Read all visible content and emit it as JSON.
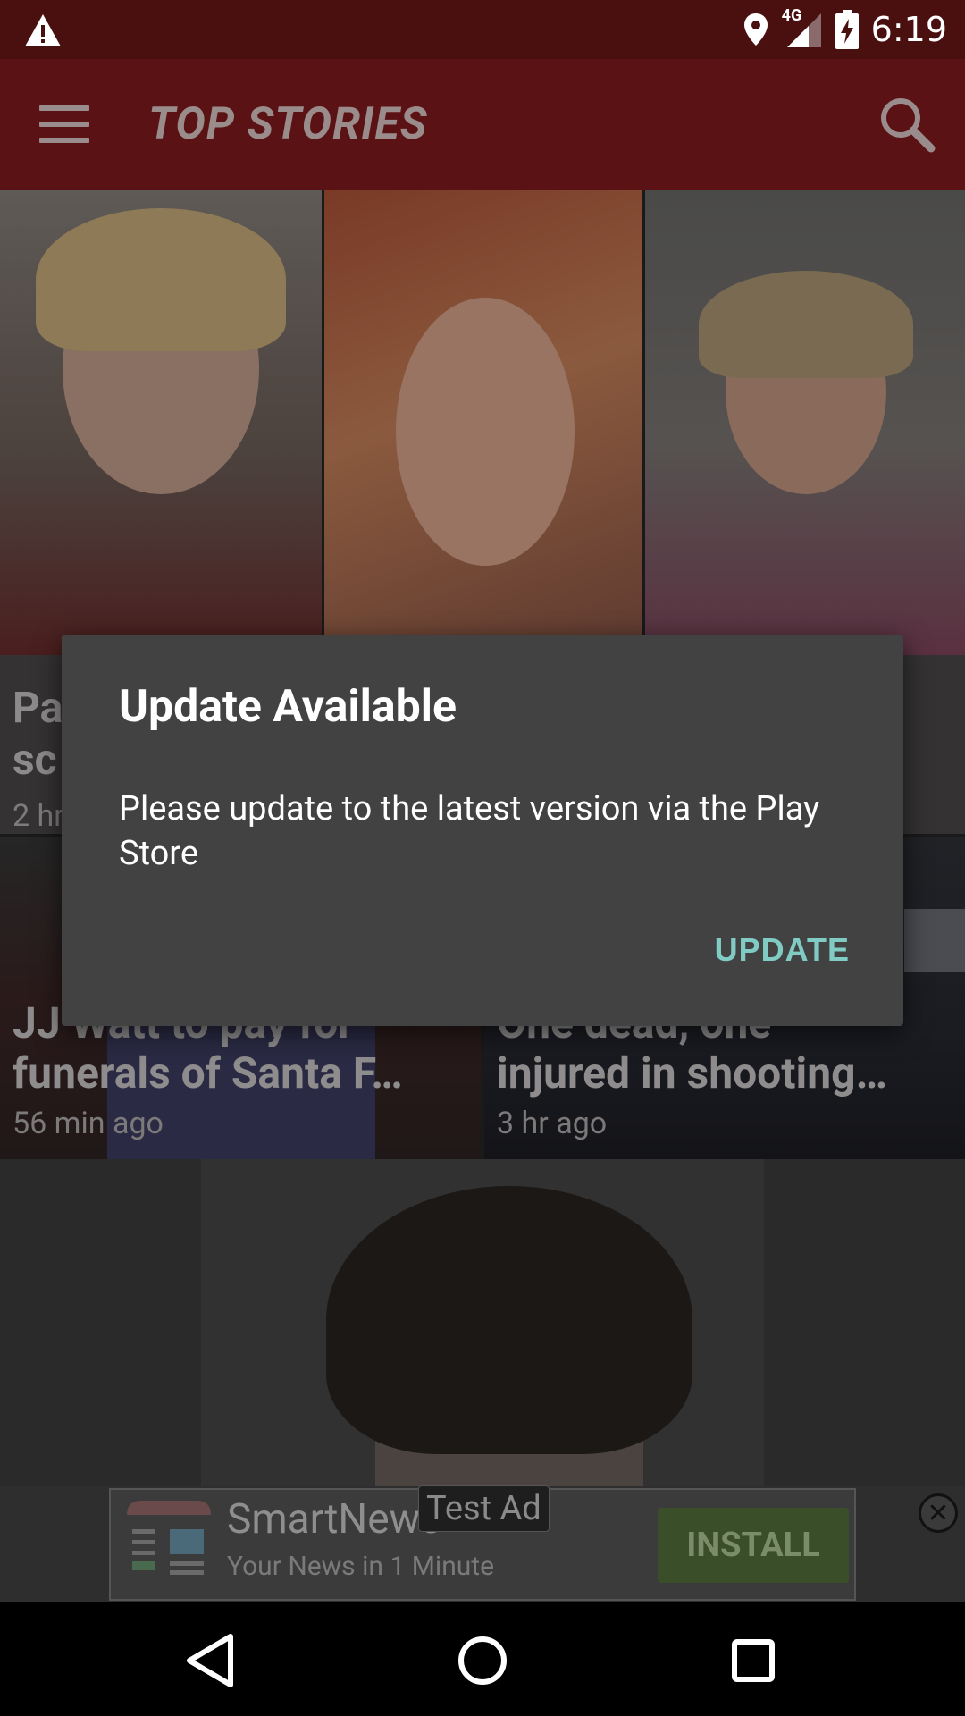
{
  "status_bar": {
    "time": "6:19",
    "network_label": "4G",
    "icons": [
      "warning-icon",
      "location-icon",
      "signal-icon",
      "battery-charging-icon"
    ]
  },
  "app_bar": {
    "title": "TOP STORIES",
    "icons": [
      "menu-icon",
      "search-icon"
    ]
  },
  "stories": [
    {
      "headline": "Pa                                                                          e\nsc",
      "ago": "2 hr"
    },
    {
      "headline": "JJ Watt to pay for\nfunerals of Santa F…",
      "ago": "56 min ago"
    },
    {
      "headline": "One dead, one\ninjured in shooting…",
      "ago": "3 hr ago"
    }
  ],
  "ad": {
    "app_name": "SmartNews",
    "tagline": "Your News in 1 Minute",
    "install_label": "INSTALL",
    "test_label": "Test Ad",
    "close_symbol": "✕"
  },
  "dialog": {
    "title": "Update Available",
    "message": "Please update to the latest version via the Play Store",
    "button": "UPDATE"
  },
  "colors": {
    "app_bar": "#5a1214",
    "status_bar": "#4a1010",
    "dialog_bg": "#424242",
    "dialog_button": "#80cbc4"
  }
}
